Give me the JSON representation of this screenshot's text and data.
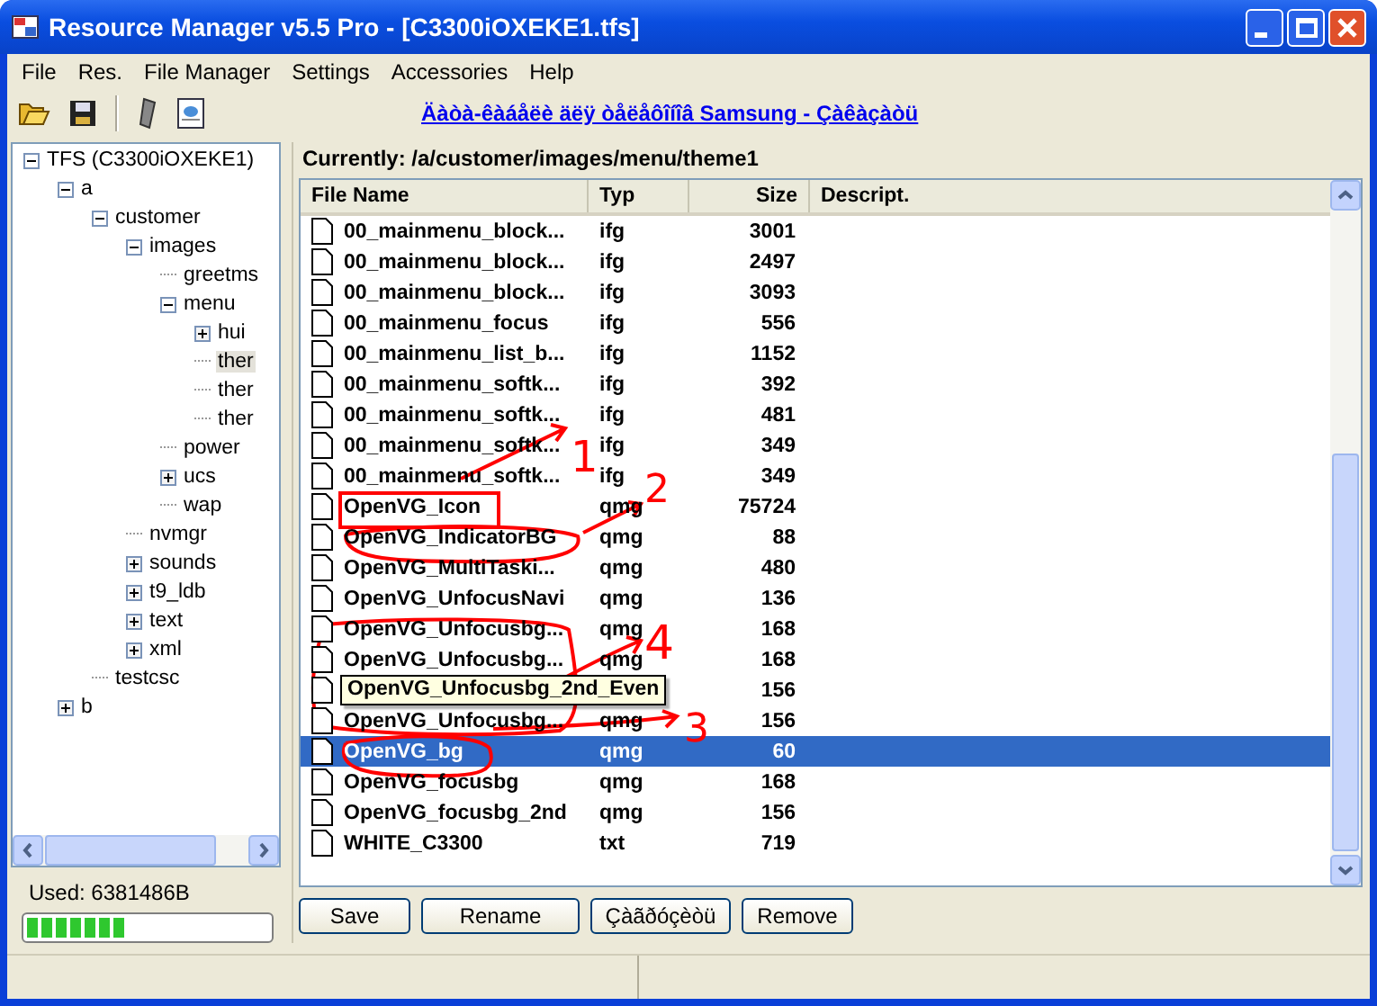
{
  "window": {
    "title": "Resource Manager v5.5 Pro - [C3300iOXEKE1.tfs]"
  },
  "menu": [
    "File",
    "Res.",
    "File Manager",
    "Settings",
    "Accessories",
    "Help"
  ],
  "toolbar": {
    "link": "Äàòà-êàáåëè äëÿ òåëåôîíîâ Samsung - Çàêàçàòü"
  },
  "tree": [
    {
      "label": "TFS (C3300iOXEKE1)",
      "kind": "branch",
      "expanded": true,
      "selected": false,
      "children": [
        {
          "label": "a",
          "kind": "branch",
          "expanded": true,
          "selected": false,
          "children": [
            {
              "label": "customer",
              "kind": "branch",
              "expanded": true,
              "selected": false,
              "children": [
                {
                  "label": "images",
                  "kind": "branch",
                  "expanded": true,
                  "selected": false,
                  "children": [
                    {
                      "label": "greetms",
                      "kind": "leaf",
                      "selected": false
                    },
                    {
                      "label": "menu",
                      "kind": "branch",
                      "expanded": true,
                      "selected": false,
                      "children": [
                        {
                          "label": "hui",
                          "kind": "branch",
                          "expanded": false,
                          "selected": false
                        },
                        {
                          "label": "ther",
                          "kind": "leaf",
                          "selected": true
                        },
                        {
                          "label": "ther",
                          "kind": "leaf",
                          "selected": false
                        },
                        {
                          "label": "ther",
                          "kind": "leaf",
                          "selected": false
                        }
                      ]
                    },
                    {
                      "label": "power",
                      "kind": "leaf",
                      "selected": false
                    },
                    {
                      "label": "ucs",
                      "kind": "branch",
                      "expanded": false,
                      "selected": false
                    },
                    {
                      "label": "wap",
                      "kind": "leaf",
                      "selected": false
                    }
                  ]
                },
                {
                  "label": "nvmgr",
                  "kind": "leaf",
                  "selected": false
                },
                {
                  "label": "sounds",
                  "kind": "branch",
                  "expanded": false,
                  "selected": false
                },
                {
                  "label": "t9_ldb",
                  "kind": "branch",
                  "expanded": false,
                  "selected": false
                },
                {
                  "label": "text",
                  "kind": "branch",
                  "expanded": false,
                  "selected": false
                },
                {
                  "label": "xml",
                  "kind": "branch",
                  "expanded": false,
                  "selected": false
                }
              ]
            },
            {
              "label": "testcsc",
              "kind": "leaf",
              "selected": false
            }
          ]
        },
        {
          "label": "b",
          "kind": "branch",
          "expanded": false,
          "selected": false
        }
      ]
    }
  ],
  "used": {
    "label": "Used: 6381486B",
    "level": 0.4
  },
  "current_path": "Currently: /a/customer/images/menu/theme1",
  "table": {
    "columns": [
      "File Name",
      "Typ",
      "Size",
      "Descript."
    ],
    "rows": [
      {
        "name": "00_mainmenu_block...",
        "type": "ifg",
        "size": "3001",
        "selected": false
      },
      {
        "name": "00_mainmenu_block...",
        "type": "ifg",
        "size": "2497",
        "selected": false
      },
      {
        "name": "00_mainmenu_block...",
        "type": "ifg",
        "size": "3093",
        "selected": false
      },
      {
        "name": "00_mainmenu_focus",
        "type": "ifg",
        "size": "556",
        "selected": false
      },
      {
        "name": "00_mainmenu_list_b...",
        "type": "ifg",
        "size": "1152",
        "selected": false
      },
      {
        "name": "00_mainmenu_softk...",
        "type": "ifg",
        "size": "392",
        "selected": false
      },
      {
        "name": "00_mainmenu_softk...",
        "type": "ifg",
        "size": "481",
        "selected": false
      },
      {
        "name": "00_mainmenu_softk...",
        "type": "ifg",
        "size": "349",
        "selected": false
      },
      {
        "name": "00_mainmenu_softk...",
        "type": "ifg",
        "size": "349",
        "selected": false
      },
      {
        "name": "OpenVG_Icon",
        "type": "qmg",
        "size": "75724",
        "selected": false
      },
      {
        "name": "OpenVG_IndicatorBG",
        "type": "qmg",
        "size": "88",
        "selected": false
      },
      {
        "name": "OpenVG_MultiTaski...",
        "type": "qmg",
        "size": "480",
        "selected": false
      },
      {
        "name": "OpenVG_UnfocusNavi",
        "type": "qmg",
        "size": "136",
        "selected": false
      },
      {
        "name": "OpenVG_Unfocusbg...",
        "type": "qmg",
        "size": "168",
        "selected": false
      },
      {
        "name": "OpenVG_Unfocusbg...",
        "type": "qmg",
        "size": "168",
        "selected": false
      },
      {
        "size": "156",
        "selected": false,
        "tooltip": "OpenVG_Unfocusbg_2nd_Even"
      },
      {
        "name": "OpenVG_Unfocusbg...",
        "type": "qmg",
        "size": "156",
        "selected": false
      },
      {
        "name": "OpenVG_bg",
        "type": "qmg",
        "size": "60",
        "selected": true
      },
      {
        "name": "OpenVG_focusbg",
        "type": "qmg",
        "size": "168",
        "selected": false
      },
      {
        "name": "OpenVG_focusbg_2nd",
        "type": "qmg",
        "size": "156",
        "selected": false
      },
      {
        "name": "WHITE_C3300",
        "type": "txt",
        "size": "719",
        "selected": false
      }
    ]
  },
  "annotation_numbers": [
    "1",
    "2",
    "4",
    "3"
  ],
  "buttons": [
    "Save",
    "Rename",
    "Çàãðóçèòü",
    "Remove"
  ]
}
